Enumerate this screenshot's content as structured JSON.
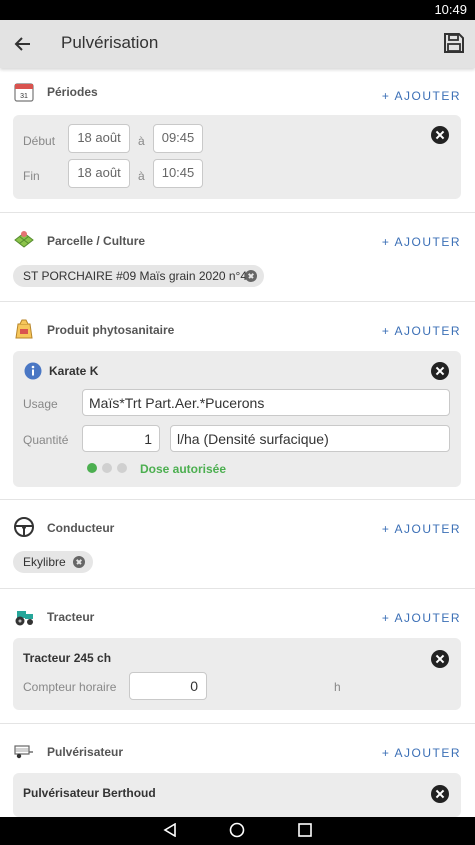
{
  "status": {
    "time": "10:49"
  },
  "appbar": {
    "title": "Pulvérisation"
  },
  "add_label": "+ AJOUTER",
  "periods": {
    "title": "Périodes",
    "calendar_day": "31",
    "start_label": "Début",
    "end_label": "Fin",
    "at_label": "à",
    "start_date": "18 août",
    "start_time": "09:45",
    "end_date": "18 août",
    "end_time": "10:45"
  },
  "parcel": {
    "title": "Parcelle / Culture",
    "chip": "ST PORCHAIRE #09 Maïs grain 2020 n°4"
  },
  "product": {
    "title": "Produit phytosanitaire",
    "name": "Karate K",
    "usage_label": "Usage",
    "usage_value": "Maïs*Trt Part.Aer.*Pucerons",
    "quantity_label": "Quantité",
    "quantity_value": "1",
    "unit_value": "l/ha (Densité surfacique)",
    "dose_status": "Dose autorisée",
    "dose_level": 1,
    "dose_level_max": 3,
    "dose_color": "#4caf50"
  },
  "driver": {
    "title": "Conducteur",
    "chip": "Ekylibre"
  },
  "tractor": {
    "title": "Tracteur",
    "name": "Tracteur 245 ch",
    "counter_label": "Compteur horaire",
    "counter_value": "0",
    "counter_unit": "h"
  },
  "sprayer": {
    "title": "Pulvérisateur",
    "name": "Pulvérisateur Berthoud"
  },
  "colors": {
    "accent": "#3b6fb6",
    "appbar": "#e3e3e3",
    "card": "#ececec"
  }
}
